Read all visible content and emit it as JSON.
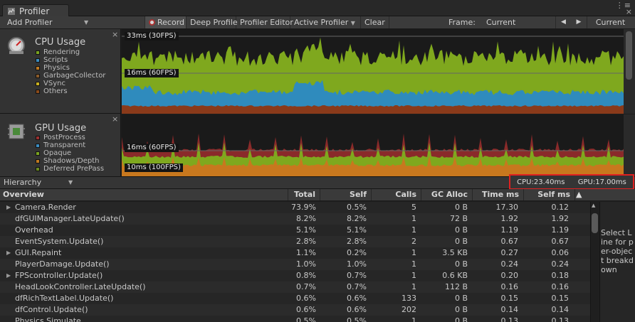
{
  "window": {
    "tab_title": "Profiler",
    "menu_icon": "kebab-icon",
    "close_icon": "close-icon"
  },
  "toolbar": {
    "add_profiler": "Add Profiler",
    "record": "Record",
    "deep_profile": "Deep Profile",
    "profile_editor": "Profiler Editor",
    "active_profiler": "Active Profiler",
    "clear": "Clear",
    "frame_label": "Frame:",
    "frame_value": "Current",
    "prev_icon": "◀",
    "next_icon": "▶",
    "current_button": "Current"
  },
  "cpu_panel": {
    "title": "CPU Usage",
    "legend": [
      {
        "label": "Rendering",
        "color": "#7aa320"
      },
      {
        "label": "Scripts",
        "color": "#3a8cc0"
      },
      {
        "label": "Physics",
        "color": "#c07a20"
      },
      {
        "label": "GarbageCollector",
        "color": "#8a5a2a"
      },
      {
        "label": "VSync",
        "color": "#c8b020"
      },
      {
        "label": "Others",
        "color": "#8a4a1a"
      }
    ],
    "label_33ms": "33ms (30FPS)",
    "label_16ms": "16ms (60FPS)"
  },
  "gpu_panel": {
    "title": "GPU Usage",
    "legend": [
      {
        "label": "PostProcess",
        "color": "#9a3030"
      },
      {
        "label": "Transparent",
        "color": "#3a8cc0"
      },
      {
        "label": "Opaque",
        "color": "#7aa320"
      },
      {
        "label": "Shadows/Depth",
        "color": "#c07a20"
      },
      {
        "label": "Deferred PrePass",
        "color": "#6a8a20"
      }
    ],
    "label_16ms": "16ms (60FPS)",
    "label_10ms": "10ms (100FPS)"
  },
  "hierarchy": {
    "dropdown": "Hierarchy",
    "cpu_time": "CPU:23.40ms",
    "gpu_time": "GPU:17.00ms"
  },
  "table": {
    "headers": [
      "Overview",
      "Total",
      "Self",
      "Calls",
      "GC Alloc",
      "Time ms",
      "Self ms"
    ],
    "rows": [
      {
        "name": "Camera.Render",
        "expand": true,
        "total": "73.9%",
        "self": "0.5%",
        "calls": "5",
        "gc": "0 B",
        "time": "17.30",
        "selfms": "0.12"
      },
      {
        "name": "dfGUIManager.LateUpdate()",
        "expand": false,
        "total": "8.2%",
        "self": "8.2%",
        "calls": "1",
        "gc": "72 B",
        "time": "1.92",
        "selfms": "1.92"
      },
      {
        "name": "Overhead",
        "expand": false,
        "total": "5.1%",
        "self": "5.1%",
        "calls": "1",
        "gc": "0 B",
        "time": "1.19",
        "selfms": "1.19"
      },
      {
        "name": "EventSystem.Update()",
        "expand": false,
        "total": "2.8%",
        "self": "2.8%",
        "calls": "2",
        "gc": "0 B",
        "time": "0.67",
        "selfms": "0.67"
      },
      {
        "name": "GUI.Repaint",
        "expand": true,
        "total": "1.1%",
        "self": "0.2%",
        "calls": "1",
        "gc": "3.5 KB",
        "time": "0.27",
        "selfms": "0.06"
      },
      {
        "name": "PlayerDamage.Update()",
        "expand": false,
        "total": "1.0%",
        "self": "1.0%",
        "calls": "1",
        "gc": "0 B",
        "time": "0.24",
        "selfms": "0.24"
      },
      {
        "name": "FPScontroller.Update()",
        "expand": true,
        "total": "0.8%",
        "self": "0.7%",
        "calls": "1",
        "gc": "0.6 KB",
        "time": "0.20",
        "selfms": "0.18"
      },
      {
        "name": "HeadLookController.LateUpdate()",
        "expand": false,
        "total": "0.7%",
        "self": "0.7%",
        "calls": "1",
        "gc": "112 B",
        "time": "0.16",
        "selfms": "0.16"
      },
      {
        "name": "dfRichTextLabel.Update()",
        "expand": false,
        "total": "0.6%",
        "self": "0.6%",
        "calls": "133",
        "gc": "0 B",
        "time": "0.15",
        "selfms": "0.15"
      },
      {
        "name": "dfControl.Update()",
        "expand": false,
        "total": "0.6%",
        "self": "0.6%",
        "calls": "202",
        "gc": "0 B",
        "time": "0.14",
        "selfms": "0.14"
      },
      {
        "name": "Physics.Simulate",
        "expand": false,
        "total": "0.5%",
        "self": "0.5%",
        "calls": "1",
        "gc": "0 B",
        "time": "0.13",
        "selfms": "0.13"
      }
    ]
  },
  "detail": {
    "text": "Select Line for per-object breakdown"
  }
}
